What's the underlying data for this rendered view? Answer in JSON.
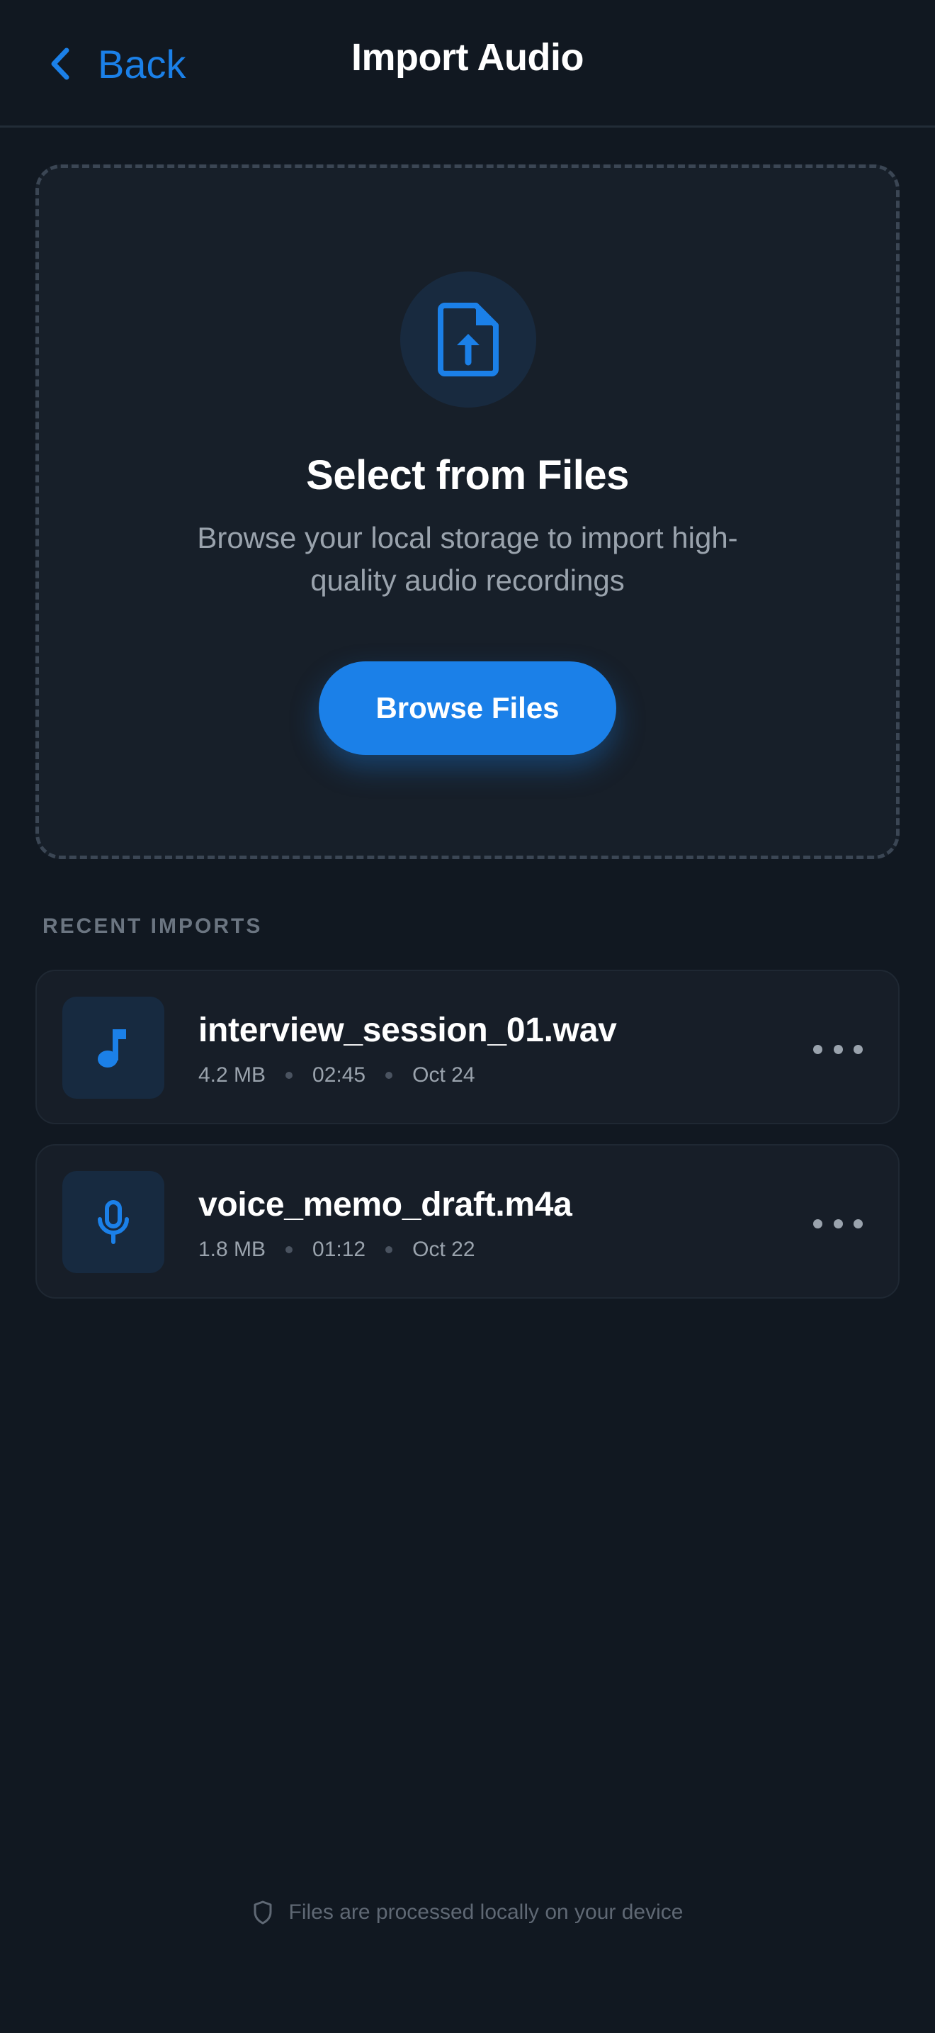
{
  "header": {
    "back_label": "Back",
    "title": "Import Audio"
  },
  "dropzone": {
    "icon": "file-upload-icon",
    "title": "Select from Files",
    "subtitle": "Browse your local storage to import high-quality audio recordings",
    "button_label": "Browse Files"
  },
  "recent": {
    "section_label": "RECENT IMPORTS",
    "items": [
      {
        "icon": "music-note-icon",
        "name": "interview_session_01.wav",
        "size": "4.2 MB",
        "duration": "02:45",
        "date": "Oct 24"
      },
      {
        "icon": "microphone-icon",
        "name": "voice_memo_draft.m4a",
        "size": "1.8 MB",
        "duration": "01:12",
        "date": "Oct 22"
      }
    ]
  },
  "footer": {
    "icon": "shield-icon",
    "note": "Files are processed locally on your device"
  },
  "colors": {
    "background": "#111821",
    "accent": "#1b80e8",
    "card": "#171e28",
    "muted_text": "#9aa3ad"
  }
}
